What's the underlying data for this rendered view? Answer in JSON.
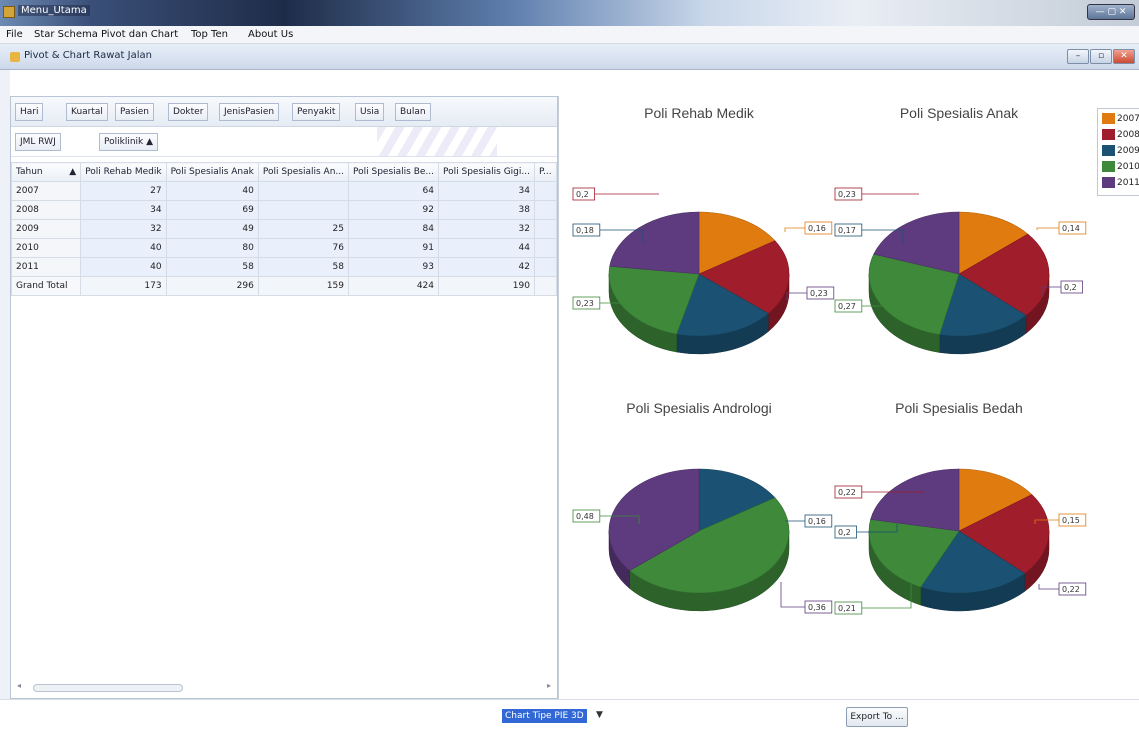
{
  "window": {
    "title": "Menu_Utama"
  },
  "menu": [
    "File",
    "Star Schema",
    "Pivot dan Chart",
    "Top Ten",
    "About Us"
  ],
  "inner_window": {
    "title": "Pivot & Chart Rawat Jalan"
  },
  "pivot": {
    "filter_fields": [
      "Hari",
      "Kuartal",
      "Pasien",
      "Dokter",
      "JenisPasien",
      "Penyakit",
      "Usia",
      "Bulan"
    ],
    "data_field": "JML RWJ",
    "column_field": "Poliklinik ▲",
    "row_field": "Tahun",
    "row_sort_icon": "▲",
    "columns": [
      "Poli Rehab Medik",
      "Poli Spesialis Anak",
      "Poli Spesialis An...",
      "Poli Spesialis Be...",
      "Poli Spesialis Gigi...",
      "P..."
    ],
    "rows": [
      {
        "label": "2007",
        "values": [
          "27",
          "40",
          "",
          "64",
          "34"
        ]
      },
      {
        "label": "2008",
        "values": [
          "34",
          "69",
          "",
          "92",
          "38"
        ]
      },
      {
        "label": "2009",
        "values": [
          "32",
          "49",
          "25",
          "84",
          "32"
        ]
      },
      {
        "label": "2010",
        "values": [
          "40",
          "80",
          "76",
          "91",
          "44"
        ]
      },
      {
        "label": "2011",
        "values": [
          "40",
          "58",
          "58",
          "93",
          "42"
        ]
      }
    ],
    "grand_total": {
      "label": "Grand Total",
      "values": [
        "173",
        "296",
        "159",
        "424",
        "190"
      ]
    }
  },
  "chart_data": [
    {
      "type": "pie",
      "title": "Poli Rehab Medik",
      "categories": [
        "2007",
        "2008",
        "2009",
        "2010",
        "2011"
      ],
      "values": [
        0.16,
        0.2,
        0.18,
        0.23,
        0.23
      ],
      "labels": [
        "0,16",
        "0,2",
        "0,18",
        "0,23",
        "0,23"
      ]
    },
    {
      "type": "pie",
      "title": "Poli Spesialis Anak",
      "categories": [
        "2007",
        "2008",
        "2009",
        "2010",
        "2011"
      ],
      "values": [
        0.14,
        0.23,
        0.17,
        0.27,
        0.2
      ],
      "labels": [
        "0,14",
        "0,23",
        "0,17",
        "0,27",
        "0,2"
      ]
    },
    {
      "type": "pie",
      "title": "Poli Spesialis Andrologi",
      "categories": [
        "2007",
        "2008",
        "2009",
        "2010",
        "2011"
      ],
      "values": [
        0,
        0,
        0.16,
        0.48,
        0.36
      ],
      "labels": [
        "",
        "",
        "0,16",
        "0,48",
        "0,36"
      ]
    },
    {
      "type": "pie",
      "title": "Poli Spesialis Bedah",
      "categories": [
        "2007",
        "2008",
        "2009",
        "2010",
        "2011"
      ],
      "values": [
        0.15,
        0.22,
        0.2,
        0.21,
        0.22
      ],
      "labels": [
        "0,15",
        "0,22",
        "0,2",
        "0,21",
        "0,22"
      ]
    }
  ],
  "legend": [
    {
      "label": "2007",
      "color": "#e07b10"
    },
    {
      "label": "2008",
      "color": "#a01d2c"
    },
    {
      "label": "2009",
      "color": "#1b5273"
    },
    {
      "label": "2010",
      "color": "#3e8a3a"
    },
    {
      "label": "2011",
      "color": "#5e3b7e"
    }
  ],
  "controls": {
    "chart_type": "Chart Tipe PIE 3D",
    "export_label": "Export To ..."
  }
}
